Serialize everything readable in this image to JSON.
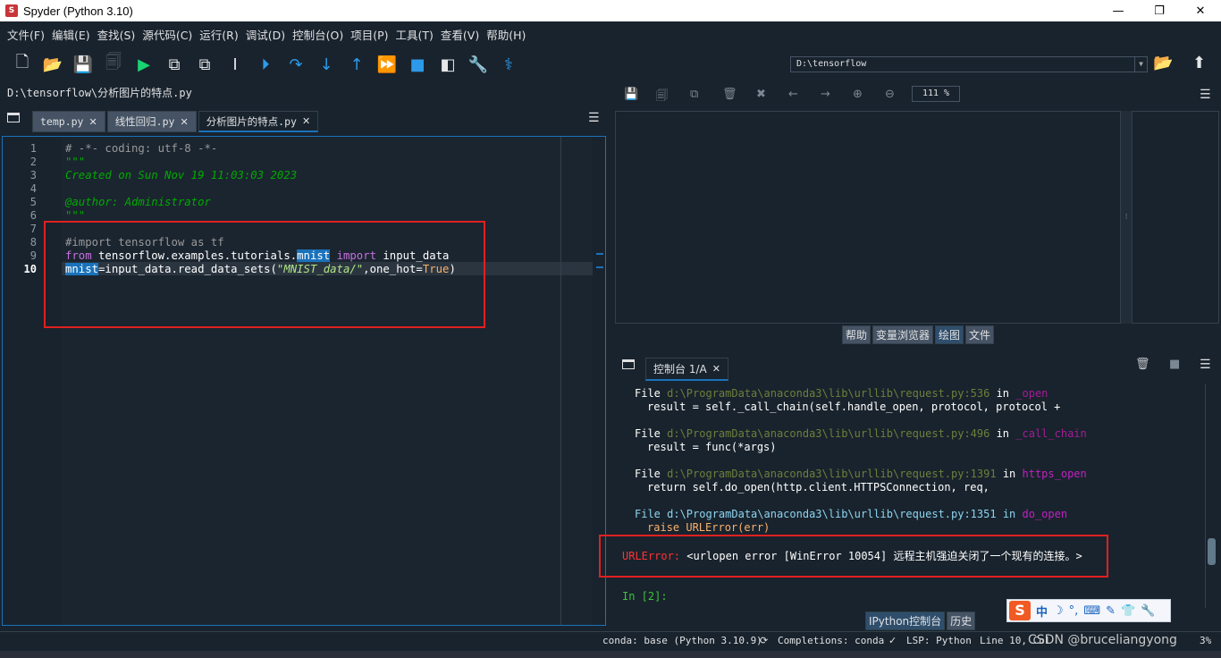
{
  "title": "Spyder (Python 3.10)",
  "window_controls": [
    "—",
    "❐",
    "✕"
  ],
  "menu": [
    "文件(F)",
    "编辑(E)",
    "查找(S)",
    "源代码(C)",
    "运行(R)",
    "调试(D)",
    "控制台(O)",
    "项目(P)",
    "工具(T)",
    "查看(V)",
    "帮助(H)"
  ],
  "working_dir": "D:\\tensorflow",
  "editor": {
    "file_path": "D:\\tensorflow\\分析图片的特点.py",
    "tabs": [
      {
        "label": "temp.py",
        "close": "✕"
      },
      {
        "label": "线性回归.py",
        "close": "✕"
      },
      {
        "label": "分析图片的特点.py",
        "close": "✕"
      }
    ],
    "line_numbers": [
      "1",
      "2",
      "3",
      "4",
      "5",
      "6",
      "7",
      "8",
      "9",
      "10"
    ],
    "lines": {
      "l1": "# -*- coding: utf-8 -*-",
      "l2": "\"\"\"",
      "l3": "Created on Sun Nov 19 11:03:03 2023",
      "l4": "",
      "l5": "@author: Administrator",
      "l6": "\"\"\"",
      "l7": "",
      "l8": "#import tensorflow as tf",
      "l9_kw1": "from",
      "l9_a": " tensorflow.examples.tutorials.",
      "l9_hl": "mnist",
      "l9_kw2": " import",
      "l9_b": " input_data",
      "l10_hl": "mnist",
      "l10_a": "=input_data.read_data_sets(",
      "l10_str": "\"MNIST_data/\"",
      "l10_b": ",one_hot=",
      "l10_kc": "True",
      "l10_c": ")"
    }
  },
  "plots": {
    "zoom": "111 %",
    "pane_tabs": [
      "帮助",
      "变量浏览器",
      "绘图",
      "文件"
    ],
    "active_tab": "绘图"
  },
  "console": {
    "tab_label": "控制台 1/A",
    "tab_close": "✕",
    "output": {
      "f1_kw": "File ",
      "f1_path": "d:\\ProgramData\\anaconda3\\lib\\urllib\\request.py:536",
      "f1_in": " in ",
      "f1_fn": "_open",
      "f1_code": "result = self._call_chain(self.handle_open, protocol, protocol +",
      "f2_kw": "File ",
      "f2_path": "d:\\ProgramData\\anaconda3\\lib\\urllib\\request.py:496",
      "f2_in": " in ",
      "f2_fn": "_call_chain",
      "f2_code": "result = func(*args)",
      "f3_kw": "File ",
      "f3_path": "d:\\ProgramData\\anaconda3\\lib\\urllib\\request.py:1391",
      "f3_in": " in ",
      "f3_fn": "https_open",
      "f3_code": "return self.do_open(http.client.HTTPSConnection, req,",
      "f4_kw": "File ",
      "f4_path": "d:\\ProgramData\\anaconda3\\lib\\urllib\\request.py:1351",
      "f4_in": " in ",
      "f4_fn": "do_open",
      "f4_code": "raise URLError(err)",
      "err_type": "URLError:",
      "err_msg": " <urlopen error [WinError 10054] 远程主机强迫关闭了一个现有的连接。>",
      "prompt": "In [2]:"
    },
    "pane_tabs": [
      "IPython控制台",
      "历史"
    ],
    "active_tab": "IPython控制台"
  },
  "status": {
    "conda": "conda: base (Python 3.10.9)",
    "completions": "Completions: conda",
    "lsp": "LSP: Python",
    "line": "Line 10, Col",
    "extra": "CSDN @bruceliangyong",
    "tail": "3%"
  },
  "ime": {
    "logo": "S",
    "lang": "中",
    "items": [
      "☽",
      "°,",
      "⌨",
      "✎",
      "👕",
      "🔧"
    ]
  },
  "icons": {
    "toolbar": [
      "new-file-icon",
      "open-file-icon",
      "save-icon",
      "save-all-icon",
      "run-icon",
      "run-cell-icon",
      "run-cell-advance-icon",
      "run-selection-icon",
      "debug-icon",
      "step-over-icon",
      "step-into-icon",
      "step-out-icon",
      "continue-icon",
      "stop-icon",
      "maximize-pane-icon",
      "preferences-icon",
      "python-path-icon"
    ]
  },
  "colors": {
    "background": "#19232d",
    "accent": "#1a72bb",
    "error": "#ff3333",
    "prompt": "#3ec43e"
  }
}
